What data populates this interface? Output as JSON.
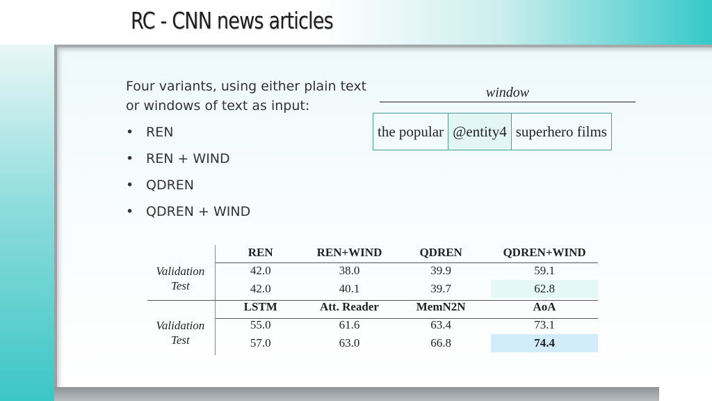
{
  "slide": {
    "title": "RC - CNN news articles",
    "intro_line1": "Four variants, using either plain text",
    "intro_line2": "or windows of text as input:",
    "bullets": [
      "REN",
      "REN + WIND",
      "QDREN",
      "QDREN + WIND"
    ]
  },
  "window_figure": {
    "label": "window",
    "cells": [
      "the popular",
      "@entity4",
      "superhero films"
    ]
  },
  "results_table": {
    "block1": {
      "headers": [
        "REN",
        "REN+WIND",
        "QDREN",
        "QDREN+WIND"
      ],
      "rows": [
        {
          "label": "Validation",
          "values": [
            "42.0",
            "38.0",
            "39.9",
            "59.1"
          ]
        },
        {
          "label": "Test",
          "values": [
            "42.0",
            "40.1",
            "39.7",
            "62.8"
          ]
        }
      ]
    },
    "block2": {
      "headers": [
        "LSTM",
        "Att. Reader",
        "MemN2N",
        "AoA"
      ],
      "rows": [
        {
          "label": "Validation",
          "values": [
            "55.0",
            "61.6",
            "63.4",
            "73.1"
          ]
        },
        {
          "label": "Test",
          "values": [
            "57.0",
            "63.0",
            "66.8",
            "74.4"
          ]
        }
      ]
    }
  },
  "colors": {
    "accent_teal": "#35c9c9",
    "highlight_light": "#e6f8f5",
    "highlight_blue": "#d2ecfb"
  }
}
